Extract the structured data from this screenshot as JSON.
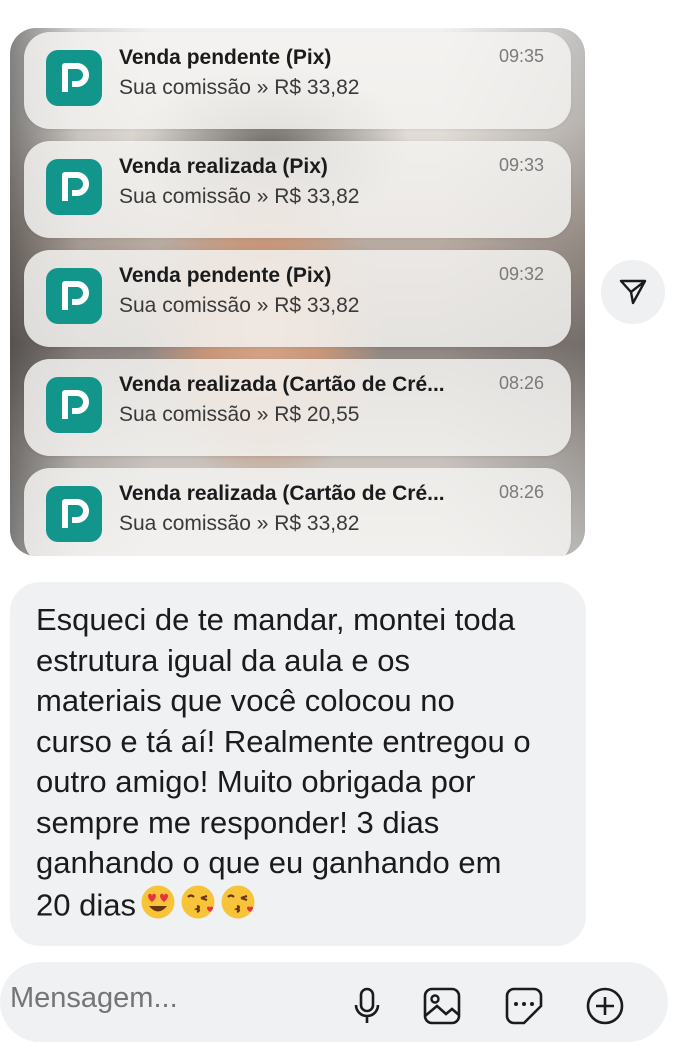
{
  "notifications": [
    {
      "title": "Venda pendente (Pix)",
      "body": "Sua comissão » R$ 33,82",
      "time": "09:35",
      "icon": "app-logo-icon"
    },
    {
      "title": "Venda realizada (Pix)",
      "body": "Sua comissão » R$ 33,82",
      "time": "09:33",
      "icon": "app-logo-icon"
    },
    {
      "title": "Venda pendente (Pix)",
      "body": "Sua comissão » R$ 33,82",
      "time": "09:32",
      "icon": "app-logo-icon"
    },
    {
      "title": "Venda realizada (Cartão de Cré...",
      "body": "Sua comissão » R$ 20,55",
      "time": "08:26",
      "icon": "app-logo-icon"
    },
    {
      "title": "Venda realizada (Cartão de Cré...",
      "body": "Sua comissão » R$ 33,82",
      "time": "08:26",
      "icon": "app-logo-icon"
    }
  ],
  "share_button": {
    "icon": "send-icon"
  },
  "message": {
    "text": "Esqueci de te mandar, montei toda\nestrutura igual da aula e os\nmateriais que você colocou no\ncurso e tá aí! Realmente entregou o\noutro amigo! Muito obrigada por\nsempre me responder! 3 dias\nganhando o que eu ganhando em\n20 dias",
    "emojis": [
      "heart-eyes-emoji",
      "kiss-emoji",
      "kiss-emoji"
    ]
  },
  "composer": {
    "placeholder": "Mensagem...",
    "icons": [
      "microphone-icon",
      "gallery-icon",
      "sticker-icon",
      "plus-icon"
    ]
  },
  "colors": {
    "app_icon": "#12958b",
    "bubble": "#f0f1f3",
    "emoji_face": "#f7c338",
    "heart": "#e8313f"
  }
}
